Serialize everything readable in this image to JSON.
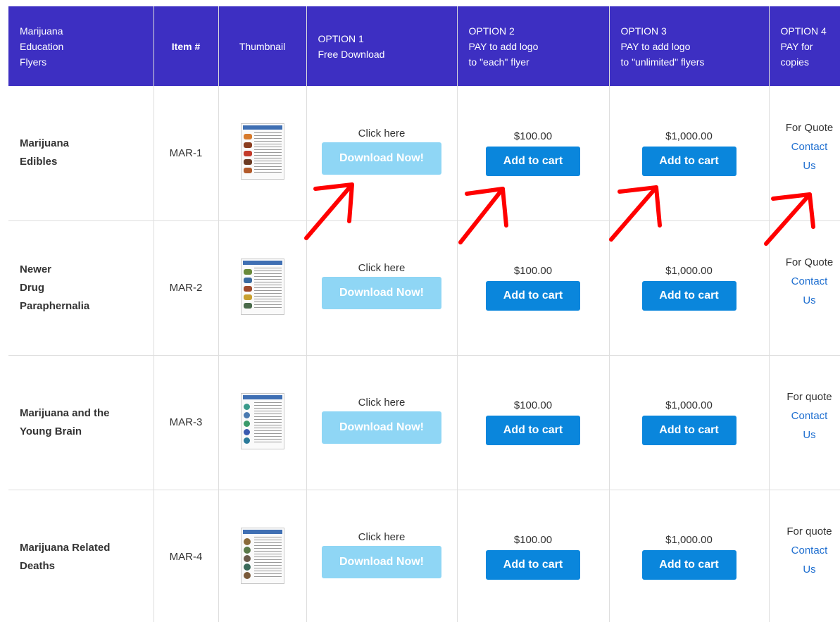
{
  "header": {
    "col1": "Marijuana\nEducation\nFlyers",
    "col2": "Item #",
    "col3": "Thumbnail",
    "col4": "OPTION 1\nFree Download",
    "col5": "OPTION 2\nPAY to add logo\nto \"each\" flyer",
    "col6": "OPTION 3\nPAY to add logo\nto \"unlimited\" flyers",
    "col7": "OPTION 4\nPAY for\ncopies"
  },
  "rows": [
    {
      "name": "Marijuana\nEdibles",
      "item": "MAR-1",
      "click_label": "Click here",
      "download_label": "Download Now!",
      "price2": "$100.00",
      "price3": "$1,000.00",
      "cart_label": "Add to cart",
      "quote": "For Quote",
      "contact": "Contact\nUs"
    },
    {
      "name": "Newer\nDrug\nParaphernalia",
      "item": "MAR-2",
      "click_label": "Click here",
      "download_label": "Download Now!",
      "price2": "$100.00",
      "price3": "$1,000.00",
      "cart_label": "Add to cart",
      "quote": "For Quote",
      "contact": "Contact\nUs"
    },
    {
      "name": "Marijuana and the\nYoung Brain",
      "item": "MAR-3",
      "click_label": "Click here",
      "download_label": "Download Now!",
      "price2": "$100.00",
      "price3": "$1,000.00",
      "cart_label": "Add to cart",
      "quote": "For quote",
      "contact": "Contact\nUs"
    },
    {
      "name": "Marijuana Related\nDeaths",
      "item": "MAR-4",
      "click_label": "Click here",
      "download_label": "Download Now!",
      "price2": "$100.00",
      "price3": "$1,000.00",
      "cart_label": "Add to cart",
      "quote": "For quote",
      "contact": "Contact\nUs"
    }
  ],
  "colors": {
    "header_bg": "#3d2fc2",
    "download_btn": "#8fd6f5",
    "cart_btn": "#0a86dc",
    "link": "#1f6fd0",
    "annotation_arrow": "#ff0000"
  },
  "icons": [
    "thumbnail-flyer-image",
    "red-arrow-annotation"
  ]
}
